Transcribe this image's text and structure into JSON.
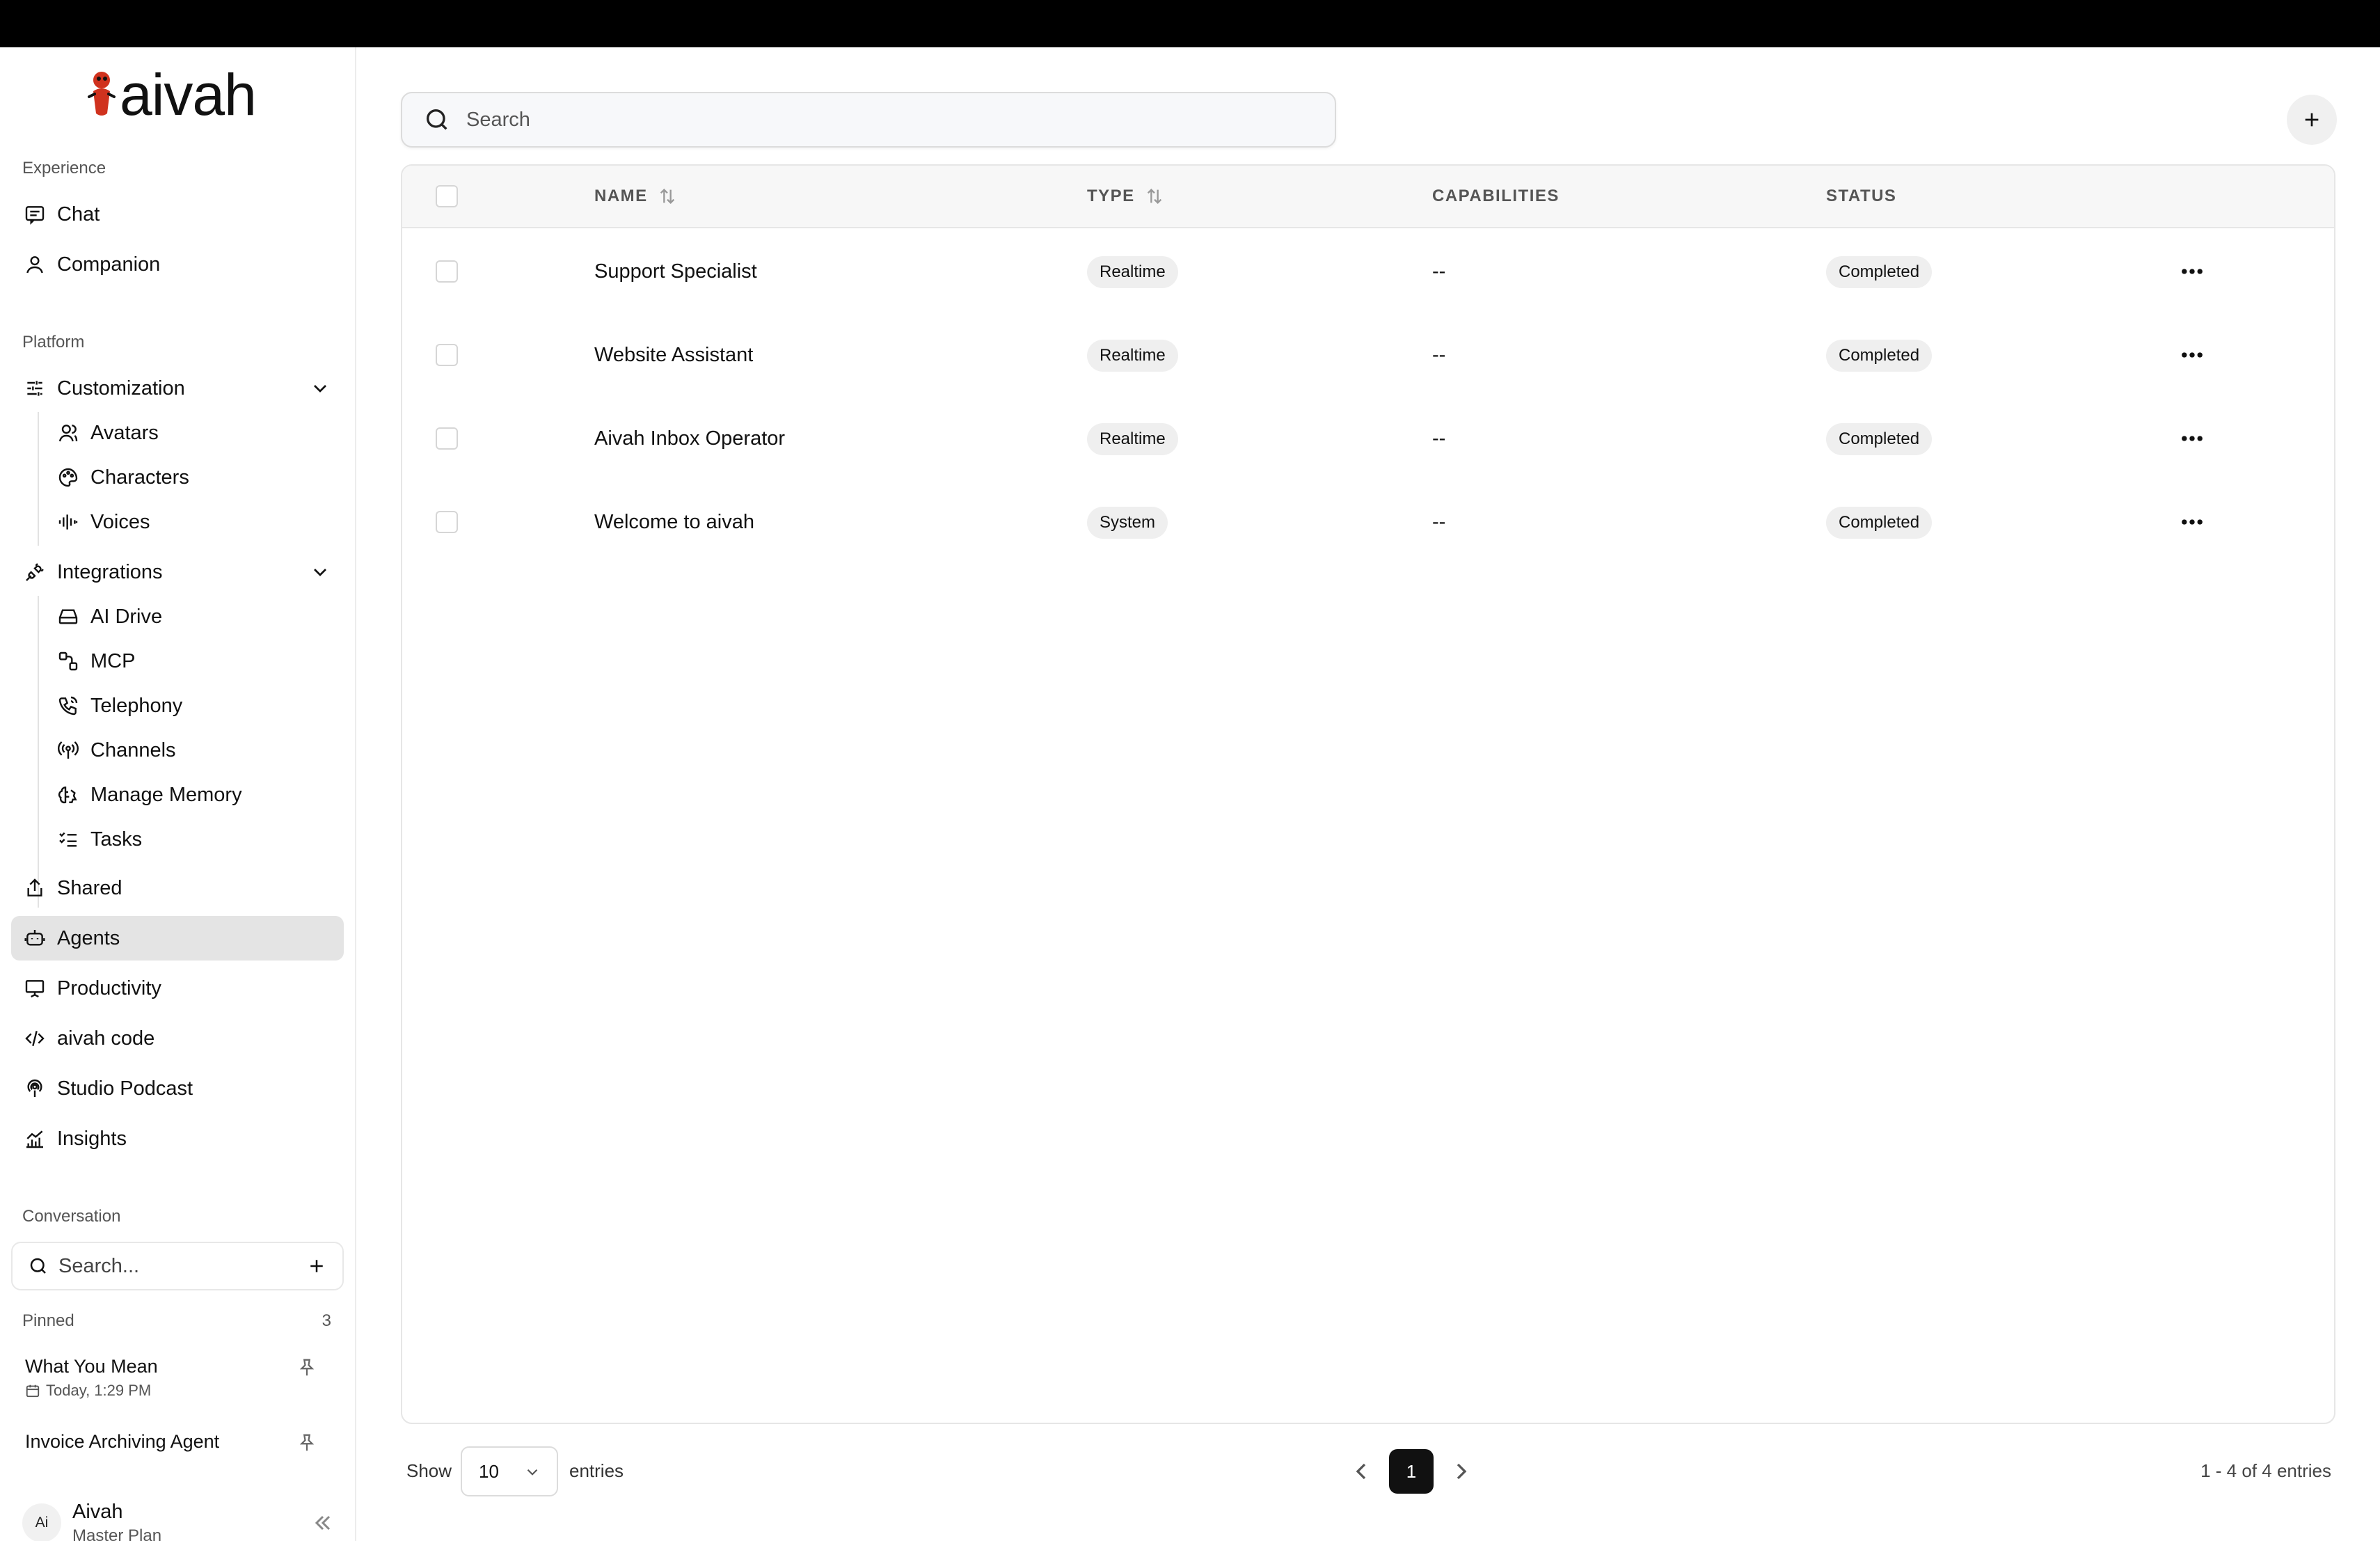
{
  "brand": {
    "name": "aivah",
    "accent": "#d0321e"
  },
  "sidebar": {
    "experience_label": "Experience",
    "experience_items": [
      {
        "label": "Chat",
        "icon": "chat-icon"
      },
      {
        "label": "Companion",
        "icon": "user-icon"
      }
    ],
    "platform_label": "Platform",
    "customization": {
      "label": "Customization",
      "icon": "sliders-icon",
      "children": [
        {
          "label": "Avatars",
          "icon": "avatars-icon"
        },
        {
          "label": "Characters",
          "icon": "palette-icon"
        },
        {
          "label": "Voices",
          "icon": "audio-wave-icon"
        }
      ]
    },
    "integrations": {
      "label": "Integrations",
      "icon": "plug-icon",
      "children": [
        {
          "label": "AI Drive",
          "icon": "drive-icon"
        },
        {
          "label": "MCP",
          "icon": "mcp-icon"
        },
        {
          "label": "Telephony",
          "icon": "phone-icon"
        },
        {
          "label": "Channels",
          "icon": "broadcast-icon"
        },
        {
          "label": "Manage Memory",
          "icon": "brain-icon"
        },
        {
          "label": "Tasks",
          "icon": "tasks-icon"
        }
      ]
    },
    "platform_items": [
      {
        "label": "Shared",
        "icon": "share-icon"
      },
      {
        "label": "Agents",
        "icon": "bot-icon",
        "active": true
      },
      {
        "label": "Productivity",
        "icon": "presentation-icon"
      },
      {
        "label": "aivah code",
        "icon": "code-icon"
      },
      {
        "label": "Studio Podcast",
        "icon": "podcast-icon"
      },
      {
        "label": "Insights",
        "icon": "chart-icon"
      }
    ],
    "conversation_label": "Conversation",
    "conversation_search_placeholder": "Search...",
    "pinned_label": "Pinned",
    "pinned_count": "3",
    "pinned": [
      {
        "title": "What You Mean",
        "time": "Today, 1:29 PM"
      },
      {
        "title": "Invoice Archiving Agent"
      }
    ],
    "user": {
      "initials": "Ai",
      "name": "Aivah",
      "plan": "Master Plan"
    }
  },
  "main": {
    "search_placeholder": "Search",
    "columns": {
      "name": "NAME",
      "type": "TYPE",
      "capabilities": "CAPABILITIES",
      "status": "STATUS"
    },
    "rows": [
      {
        "name": "Support Specialist",
        "type": "Realtime",
        "capabilities": "--",
        "status": "Completed"
      },
      {
        "name": "Website Assistant",
        "type": "Realtime",
        "capabilities": "--",
        "status": "Completed"
      },
      {
        "name": "Aivah Inbox Operator",
        "type": "Realtime",
        "capabilities": "--",
        "status": "Completed"
      },
      {
        "name": "Welcome to aivah",
        "type": "System",
        "capabilities": "--",
        "status": "Completed"
      }
    ],
    "footer": {
      "show": "Show",
      "page_size": "10",
      "entries": "entries",
      "current_page": "1",
      "range": "1 - 4 of 4 entries"
    }
  }
}
